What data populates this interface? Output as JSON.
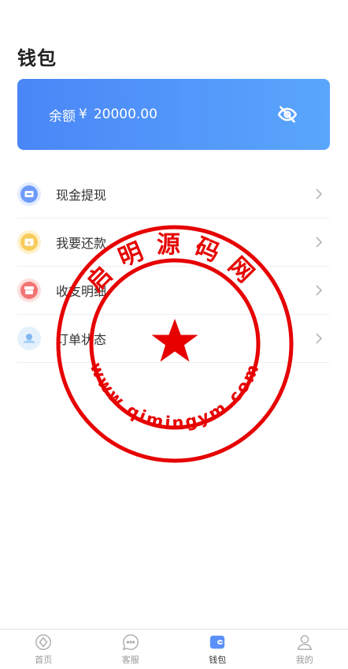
{
  "page": {
    "title": "钱包"
  },
  "balance": {
    "label": "余额",
    "currency": "¥",
    "amount": "20000.00",
    "toggle_icon": "eye-off-icon"
  },
  "menu": [
    {
      "label": "现金提现",
      "icon": "cash-withdraw-icon",
      "color": "#5b8ff9"
    },
    {
      "label": "我要还款",
      "icon": "repay-icon",
      "color": "#f9c74f"
    },
    {
      "label": "收支明细",
      "icon": "transactions-icon",
      "color": "#f26b6b"
    },
    {
      "label": "订单状态",
      "icon": "order-status-icon",
      "color": "#8ec5f5"
    }
  ],
  "watermark": {
    "top_text": "启明源码网",
    "bottom_text": "www.qimingym.com",
    "color": "#e60000"
  },
  "tabbar": [
    {
      "label": "首页",
      "icon": "home-icon",
      "active": false
    },
    {
      "label": "客服",
      "icon": "chat-icon",
      "active": false
    },
    {
      "label": "钱包",
      "icon": "wallet-icon",
      "active": true
    },
    {
      "label": "我的",
      "icon": "user-icon",
      "active": false
    }
  ],
  "colors": {
    "card_start": "#4a86f7",
    "card_end": "#5aa6fc",
    "tab_active": "#5b8ff9"
  }
}
